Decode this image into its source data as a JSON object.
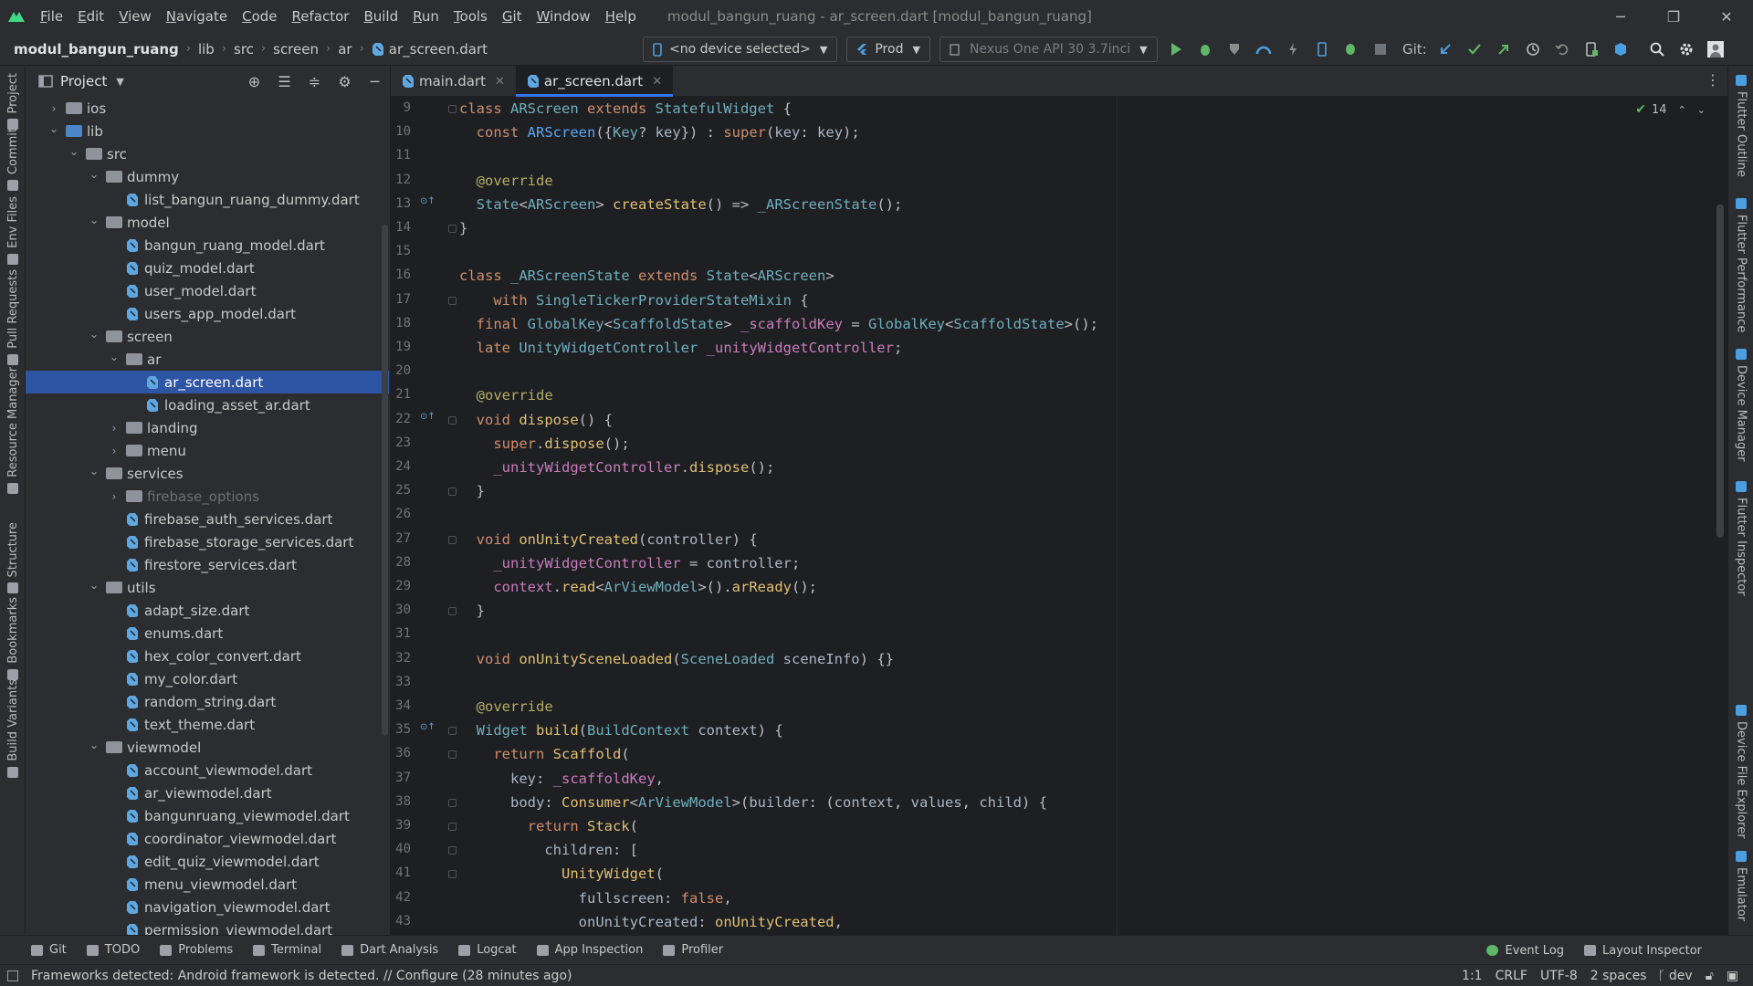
{
  "menubar": {
    "items": [
      "File",
      "Edit",
      "View",
      "Navigate",
      "Code",
      "Refactor",
      "Build",
      "Run",
      "Tools",
      "Git",
      "Window",
      "Help"
    ],
    "window_title": "modul_bangun_ruang - ar_screen.dart [modul_bangun_ruang]"
  },
  "navbar": {
    "breadcrumb": [
      "modul_bangun_ruang",
      "lib",
      "src",
      "screen",
      "ar",
      "ar_screen.dart"
    ],
    "device_combo": "<no device selected>",
    "flavor_combo": "Prod",
    "emulator_combo": "Nexus One API 30 3.7inci",
    "git_label": "Git:"
  },
  "left_stripe": [
    "Project",
    "Commit",
    "Env Files",
    "Pull Requests",
    "Resource Manager",
    "Structure",
    "Bookmarks",
    "Build Variants"
  ],
  "right_stripe": [
    "Flutter Outline",
    "Flutter Performance",
    "Device Manager",
    "Flutter Inspector",
    "Device File Explorer",
    "Emulator"
  ],
  "project_panel": {
    "title": "Project",
    "tree": [
      {
        "label": "ios",
        "type": "folder",
        "depth": 1,
        "expanded": false
      },
      {
        "label": "lib",
        "type": "folder-blue",
        "depth": 1,
        "expanded": true
      },
      {
        "label": "src",
        "type": "folder",
        "depth": 2,
        "expanded": true
      },
      {
        "label": "dummy",
        "type": "folder",
        "depth": 3,
        "expanded": true
      },
      {
        "label": "list_bangun_ruang_dummy.dart",
        "type": "file",
        "depth": 4
      },
      {
        "label": "model",
        "type": "folder",
        "depth": 3,
        "expanded": true
      },
      {
        "label": "bangun_ruang_model.dart",
        "type": "file",
        "depth": 4
      },
      {
        "label": "quiz_model.dart",
        "type": "file",
        "depth": 4
      },
      {
        "label": "user_model.dart",
        "type": "file",
        "depth": 4
      },
      {
        "label": "users_app_model.dart",
        "type": "file",
        "depth": 4
      },
      {
        "label": "screen",
        "type": "folder",
        "depth": 3,
        "expanded": true
      },
      {
        "label": "ar",
        "type": "folder",
        "depth": 4,
        "expanded": true
      },
      {
        "label": "ar_screen.dart",
        "type": "file",
        "depth": 5,
        "selected": true
      },
      {
        "label": "loading_asset_ar.dart",
        "type": "file",
        "depth": 5
      },
      {
        "label": "landing",
        "type": "folder",
        "depth": 4,
        "expanded": false
      },
      {
        "label": "menu",
        "type": "folder",
        "depth": 4,
        "expanded": false
      },
      {
        "label": "services",
        "type": "folder",
        "depth": 3,
        "expanded": true
      },
      {
        "label": "firebase_options",
        "type": "folder",
        "depth": 4,
        "expanded": false,
        "muted": true
      },
      {
        "label": "firebase_auth_services.dart",
        "type": "file",
        "depth": 4
      },
      {
        "label": "firebase_storage_services.dart",
        "type": "file",
        "depth": 4
      },
      {
        "label": "firestore_services.dart",
        "type": "file",
        "depth": 4
      },
      {
        "label": "utils",
        "type": "folder",
        "depth": 3,
        "expanded": true
      },
      {
        "label": "adapt_size.dart",
        "type": "file",
        "depth": 4
      },
      {
        "label": "enums.dart",
        "type": "file",
        "depth": 4
      },
      {
        "label": "hex_color_convert.dart",
        "type": "file",
        "depth": 4
      },
      {
        "label": "my_color.dart",
        "type": "file",
        "depth": 4
      },
      {
        "label": "random_string.dart",
        "type": "file",
        "depth": 4
      },
      {
        "label": "text_theme.dart",
        "type": "file",
        "depth": 4
      },
      {
        "label": "viewmodel",
        "type": "folder",
        "depth": 3,
        "expanded": true
      },
      {
        "label": "account_viewmodel.dart",
        "type": "file",
        "depth": 4
      },
      {
        "label": "ar_viewmodel.dart",
        "type": "file",
        "depth": 4
      },
      {
        "label": "bangunruang_viewmodel.dart",
        "type": "file",
        "depth": 4
      },
      {
        "label": "coordinator_viewmodel.dart",
        "type": "file",
        "depth": 4
      },
      {
        "label": "edit_quiz_viewmodel.dart",
        "type": "file",
        "depth": 4
      },
      {
        "label": "menu_viewmodel.dart",
        "type": "file",
        "depth": 4
      },
      {
        "label": "navigation_viewmodel.dart",
        "type": "file",
        "depth": 4
      },
      {
        "label": "permission_viewmodel.dart",
        "type": "file",
        "depth": 4
      }
    ]
  },
  "editor": {
    "tabs": [
      {
        "label": "main.dart",
        "active": false
      },
      {
        "label": "ar_screen.dart",
        "active": true
      }
    ],
    "inspection_count": "14",
    "lines": [
      {
        "n": 9,
        "tokens": [
          [
            "kw",
            "class "
          ],
          [
            "cls",
            "ARScreen "
          ],
          [
            "kw",
            "extends "
          ],
          [
            "cls",
            "StatefulWidget"
          ],
          [
            "p",
            " {"
          ]
        ]
      },
      {
        "n": 10,
        "tokens": [
          [
            "p",
            "  "
          ],
          [
            "kw",
            "const "
          ],
          [
            "fn",
            "ARScreen"
          ],
          [
            "p",
            "({"
          ],
          [
            "cls",
            "Key"
          ],
          [
            "p",
            "? "
          ],
          [
            "pa",
            "key"
          ],
          [
            "p",
            "}) : "
          ],
          [
            "kw",
            "super"
          ],
          [
            "p",
            "("
          ],
          [
            "pa",
            "key"
          ],
          [
            "p",
            ": "
          ],
          [
            "pa",
            "key"
          ],
          [
            "p",
            ");"
          ]
        ]
      },
      {
        "n": 11,
        "tokens": []
      },
      {
        "n": 12,
        "tokens": [
          [
            "p",
            "  "
          ],
          [
            "an",
            "@override"
          ]
        ]
      },
      {
        "n": 13,
        "tokens": [
          [
            "p",
            "  "
          ],
          [
            "cls",
            "State"
          ],
          [
            "p",
            "<"
          ],
          [
            "cls",
            "ARScreen"
          ],
          [
            "p",
            "> "
          ],
          [
            "fnc",
            "createState"
          ],
          [
            "p",
            "() => "
          ],
          [
            "cls",
            "_ARScreenState"
          ],
          [
            "p",
            "();"
          ]
        ]
      },
      {
        "n": 14,
        "tokens": [
          [
            "p",
            "}"
          ]
        ]
      },
      {
        "n": 15,
        "tokens": []
      },
      {
        "n": 16,
        "tokens": [
          [
            "kw",
            "class "
          ],
          [
            "cls",
            "_ARScreenState "
          ],
          [
            "kw",
            "extends "
          ],
          [
            "cls",
            "State"
          ],
          [
            "p",
            "<"
          ],
          [
            "cls",
            "ARScreen"
          ],
          [
            "p",
            ">"
          ]
        ]
      },
      {
        "n": 17,
        "tokens": [
          [
            "p",
            "    "
          ],
          [
            "kw",
            "with "
          ],
          [
            "cls",
            "SingleTickerProviderStateMixin"
          ],
          [
            "p",
            " {"
          ]
        ]
      },
      {
        "n": 18,
        "tokens": [
          [
            "p",
            "  "
          ],
          [
            "kw",
            "final "
          ],
          [
            "cls",
            "GlobalKey"
          ],
          [
            "p",
            "<"
          ],
          [
            "cls",
            "ScaffoldState"
          ],
          [
            "p",
            "> "
          ],
          [
            "fi",
            "_scaffoldKey"
          ],
          [
            "p",
            " = "
          ],
          [
            "cls",
            "GlobalKey"
          ],
          [
            "p",
            "<"
          ],
          [
            "cls",
            "ScaffoldState"
          ],
          [
            "p",
            ">();"
          ]
        ]
      },
      {
        "n": 19,
        "tokens": [
          [
            "p",
            "  "
          ],
          [
            "kw",
            "late "
          ],
          [
            "cls",
            "UnityWidgetController "
          ],
          [
            "fi",
            "_unityWidgetController"
          ],
          [
            "p",
            ";"
          ]
        ]
      },
      {
        "n": 20,
        "tokens": []
      },
      {
        "n": 21,
        "tokens": [
          [
            "p",
            "  "
          ],
          [
            "an",
            "@override"
          ]
        ]
      },
      {
        "n": 22,
        "tokens": [
          [
            "p",
            "  "
          ],
          [
            "kw",
            "void "
          ],
          [
            "fnc",
            "dispose"
          ],
          [
            "p",
            "() {"
          ]
        ]
      },
      {
        "n": 23,
        "tokens": [
          [
            "p",
            "    "
          ],
          [
            "kw",
            "super"
          ],
          [
            "p",
            "."
          ],
          [
            "fnc",
            "dispose"
          ],
          [
            "p",
            "();"
          ]
        ]
      },
      {
        "n": 24,
        "tokens": [
          [
            "p",
            "    "
          ],
          [
            "fi",
            "_unityWidgetController"
          ],
          [
            "p",
            "."
          ],
          [
            "fnc",
            "dispose"
          ],
          [
            "p",
            "();"
          ]
        ]
      },
      {
        "n": 25,
        "tokens": [
          [
            "p",
            "  }"
          ]
        ]
      },
      {
        "n": 26,
        "tokens": []
      },
      {
        "n": 27,
        "tokens": [
          [
            "p",
            "  "
          ],
          [
            "kw",
            "void "
          ],
          [
            "fnc",
            "onUnityCreated"
          ],
          [
            "p",
            "("
          ],
          [
            "pa",
            "controller"
          ],
          [
            "p",
            ") {"
          ]
        ]
      },
      {
        "n": 28,
        "tokens": [
          [
            "p",
            "    "
          ],
          [
            "fi",
            "_unityWidgetController"
          ],
          [
            "p",
            " = "
          ],
          [
            "pa",
            "controller"
          ],
          [
            "p",
            ";"
          ]
        ]
      },
      {
        "n": 29,
        "tokens": [
          [
            "p",
            "    "
          ],
          [
            "fi",
            "context"
          ],
          [
            "p",
            "."
          ],
          [
            "fnc",
            "read"
          ],
          [
            "p",
            "<"
          ],
          [
            "cls",
            "ArViewModel"
          ],
          [
            "p",
            ">()."
          ],
          [
            "fnc",
            "arReady"
          ],
          [
            "p",
            "();"
          ]
        ]
      },
      {
        "n": 30,
        "tokens": [
          [
            "p",
            "  }"
          ]
        ]
      },
      {
        "n": 31,
        "tokens": []
      },
      {
        "n": 32,
        "tokens": [
          [
            "p",
            "  "
          ],
          [
            "kw",
            "void "
          ],
          [
            "fnc",
            "onUnitySceneLoaded"
          ],
          [
            "p",
            "("
          ],
          [
            "cls",
            "SceneLoaded "
          ],
          [
            "pa",
            "sceneInfo"
          ],
          [
            "p",
            ") {}"
          ]
        ]
      },
      {
        "n": 33,
        "tokens": []
      },
      {
        "n": 34,
        "tokens": [
          [
            "p",
            "  "
          ],
          [
            "an",
            "@override"
          ]
        ]
      },
      {
        "n": 35,
        "tokens": [
          [
            "p",
            "  "
          ],
          [
            "cls",
            "Widget "
          ],
          [
            "fnc",
            "build"
          ],
          [
            "p",
            "("
          ],
          [
            "cls",
            "BuildContext "
          ],
          [
            "pa",
            "context"
          ],
          [
            "p",
            ") {"
          ]
        ]
      },
      {
        "n": 36,
        "tokens": [
          [
            "p",
            "    "
          ],
          [
            "kw",
            "return "
          ],
          [
            "fnc",
            "Scaffold"
          ],
          [
            "p",
            "("
          ]
        ]
      },
      {
        "n": 37,
        "tokens": [
          [
            "p",
            "      "
          ],
          [
            "pa",
            "key"
          ],
          [
            "p",
            ": "
          ],
          [
            "fi",
            "_scaffoldKey"
          ],
          [
            "p",
            ","
          ]
        ]
      },
      {
        "n": 38,
        "tokens": [
          [
            "p",
            "      "
          ],
          [
            "pa",
            "body"
          ],
          [
            "p",
            ": "
          ],
          [
            "fnc",
            "Consumer"
          ],
          [
            "p",
            "<"
          ],
          [
            "cls",
            "ArViewModel"
          ],
          [
            "p",
            ">("
          ],
          [
            "pa",
            "builder"
          ],
          [
            "p",
            ": ("
          ],
          [
            "pa",
            "context"
          ],
          [
            "p",
            ", "
          ],
          [
            "pa",
            "values"
          ],
          [
            "p",
            ", "
          ],
          [
            "pa",
            "child"
          ],
          [
            "p",
            ") {"
          ]
        ]
      },
      {
        "n": 39,
        "tokens": [
          [
            "p",
            "        "
          ],
          [
            "kw",
            "return "
          ],
          [
            "fnc",
            "Stack"
          ],
          [
            "p",
            "("
          ]
        ]
      },
      {
        "n": 40,
        "tokens": [
          [
            "p",
            "          "
          ],
          [
            "pa",
            "children"
          ],
          [
            "p",
            ": ["
          ]
        ]
      },
      {
        "n": 41,
        "tokens": [
          [
            "p",
            "            "
          ],
          [
            "fnc",
            "UnityWidget"
          ],
          [
            "p",
            "("
          ]
        ]
      },
      {
        "n": 42,
        "tokens": [
          [
            "p",
            "              "
          ],
          [
            "pa",
            "fullscreen"
          ],
          [
            "p",
            ": "
          ],
          [
            "kw",
            "false"
          ],
          [
            "p",
            ","
          ]
        ]
      },
      {
        "n": 43,
        "tokens": [
          [
            "p",
            "              "
          ],
          [
            "pa",
            "onUnityCreated"
          ],
          [
            "p",
            ": "
          ],
          [
            "fnc",
            "onUnityCreated"
          ],
          [
            "p",
            ","
          ]
        ]
      }
    ]
  },
  "bottom_tools": [
    "Git",
    "TODO",
    "Problems",
    "Terminal",
    "Dart Analysis",
    "Logcat",
    "App Inspection",
    "Profiler"
  ],
  "bottom_right_tools": [
    "Event Log",
    "Layout Inspector"
  ],
  "status": {
    "message": "Frameworks detected: Android framework is detected. // Configure (28 minutes ago)",
    "position": "1:1",
    "line_sep": "CRLF",
    "encoding": "UTF-8",
    "indent": "2 spaces",
    "branch": "dev"
  },
  "icons": {
    "logo": "android-studio-logo",
    "run": "run-icon",
    "debug": "debug-icon",
    "search": "search-icon",
    "settings": "gear-icon"
  },
  "colors": {
    "background": "#1e1f22",
    "panel": "#2b2d30",
    "selection": "#2e55a3",
    "accent": "#3574f0"
  }
}
